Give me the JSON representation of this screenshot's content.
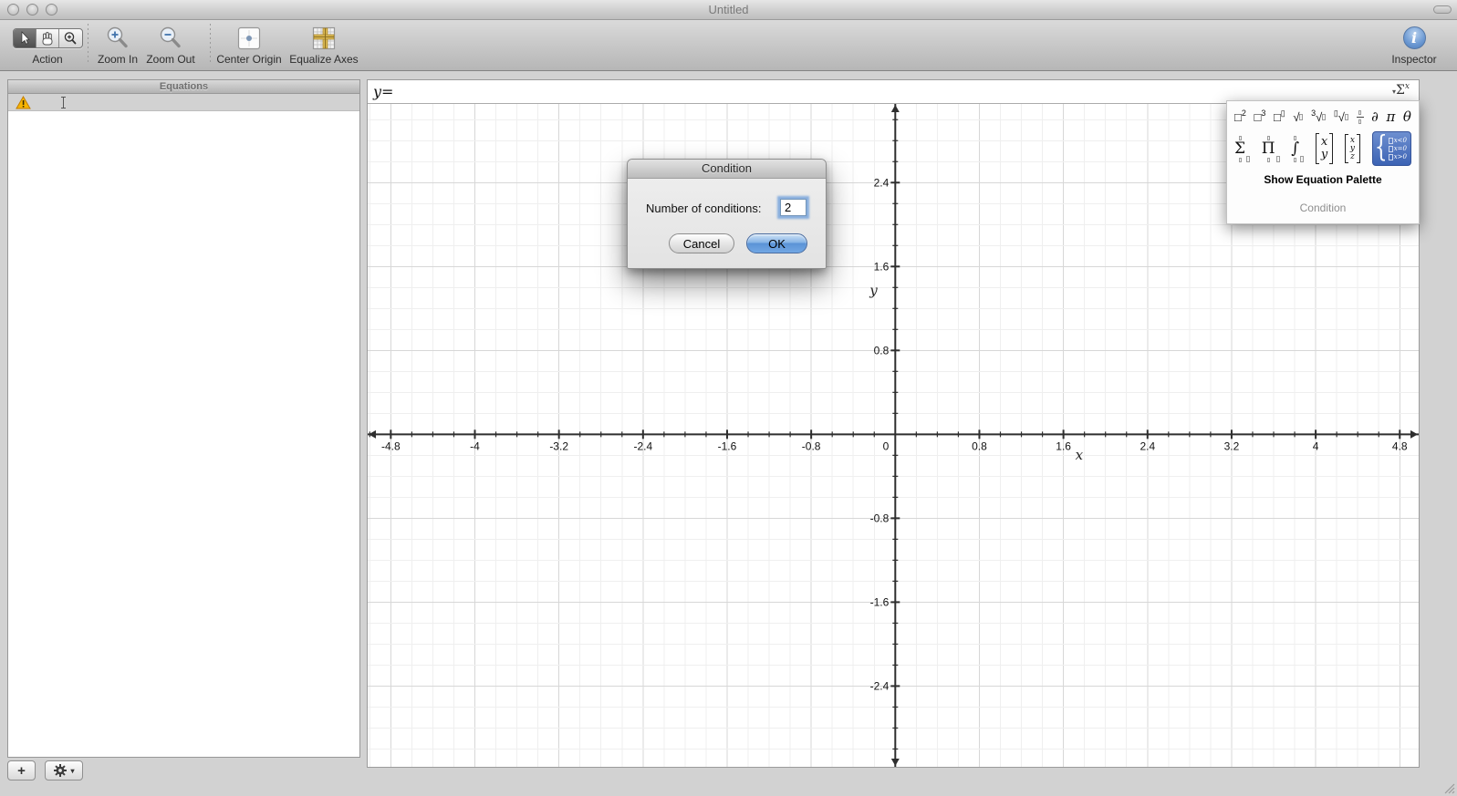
{
  "window": {
    "title": "Untitled"
  },
  "toolbar": {
    "action_label": "Action",
    "zoom_in_label": "Zoom In",
    "zoom_out_label": "Zoom Out",
    "center_origin_label": "Center Origin",
    "equalize_axes_label": "Equalize Axes",
    "inspector_label": "Inspector"
  },
  "sidebar": {
    "header": "Equations"
  },
  "sidebar_bottom": {
    "add_label": "+",
    "gear_caret": "▾"
  },
  "equation_bar": {
    "value": "y=",
    "palette_toggle": {
      "caret": "▾",
      "sigma": "Σ",
      "sup": "x"
    }
  },
  "dialog": {
    "title": "Condition",
    "label": "Number of conditions:",
    "value": "2",
    "cancel_label": "Cancel",
    "ok_label": "OK"
  },
  "palette": {
    "menu_label": "Show Equation Palette",
    "status_label": "Condition",
    "row1": [
      {
        "name": "power-2-template",
        "kind": "sup",
        "base": "□",
        "sup": "2"
      },
      {
        "name": "power-3-template",
        "kind": "sup",
        "base": "□",
        "sup": "3"
      },
      {
        "name": "power-n-template",
        "kind": "sup",
        "base": "□",
        "sup": "▯"
      },
      {
        "name": "square-root-template",
        "kind": "root",
        "base": "√"
      },
      {
        "name": "cube-root-template",
        "kind": "root",
        "base": "√",
        "pre": "3"
      },
      {
        "name": "nth-root-template",
        "kind": "root",
        "base": "√",
        "pre": "▯"
      },
      {
        "name": "fraction-template",
        "kind": "frac"
      },
      {
        "name": "partial-derivative",
        "kind": "plain",
        "base": "∂"
      },
      {
        "name": "pi-symbol",
        "kind": "plain",
        "base": "π"
      },
      {
        "name": "theta-symbol",
        "kind": "plain",
        "base": "θ"
      }
    ],
    "row2": [
      {
        "name": "summation-template",
        "kind": "bigop",
        "base": "Σ"
      },
      {
        "name": "product-template",
        "kind": "bigop",
        "base": "Π"
      },
      {
        "name": "integral-template",
        "kind": "bigop",
        "base": "∫"
      },
      {
        "name": "vector-2d-template",
        "kind": "vec2",
        "letters": [
          "x",
          "y"
        ]
      },
      {
        "name": "vector-3d-template",
        "kind": "vec3",
        "letters": [
          "x",
          "y",
          "z"
        ]
      },
      {
        "name": "condition-template",
        "kind": "piecewise",
        "rows": [
          "x<0",
          "x=0",
          "x>0"
        ],
        "selected": true
      }
    ],
    "highlight_color": "#3c63b4"
  },
  "graph": {
    "xlabel": "x",
    "ylabel": "y",
    "xmin": -5.02,
    "xmax": 4.98,
    "ymin": -3.17,
    "ymax": 3.15,
    "minor_step": 0.2,
    "major_step": 0.8,
    "x_tick_labels": [
      "-4.8",
      "-4",
      "-3.2",
      "-2.4",
      "-1.6",
      "-0.8",
      "0",
      "0.8",
      "1.6",
      "2.4",
      "3.2",
      "4",
      "4.8"
    ],
    "y_tick_labels": [
      "2.4",
      "1.6",
      "0.8",
      "-0.8",
      "-1.6",
      "-2.4"
    ],
    "xlabel_pos": [
      1.75,
      -0.24
    ],
    "ylabel_pos": [
      -0.17,
      1.33
    ],
    "colors": {
      "axis": "#2e2e2e",
      "major_grid": "#d7d7d7",
      "minor_grid": "#efefef",
      "label": "#111111"
    }
  },
  "colors": {
    "ok_button_blue": "#5b93d6",
    "focus_ring": "#78a5dc",
    "warning_yellow": "#f7b500",
    "inspector_blue": "#6b98d2"
  }
}
